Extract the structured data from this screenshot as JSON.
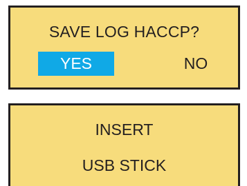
{
  "save_dialog": {
    "prompt": "SAVE LOG HACCP?",
    "yes_label": "YES",
    "no_label": "NO",
    "selected": "YES"
  },
  "usb_message": {
    "line1": "INSERT",
    "line2": "USB STICK"
  },
  "colors": {
    "panel_background": "#f7dc7c",
    "border": "#231f20",
    "selection": "#10a9e6",
    "text": "#231f20",
    "selected_text": "#ffffff"
  }
}
